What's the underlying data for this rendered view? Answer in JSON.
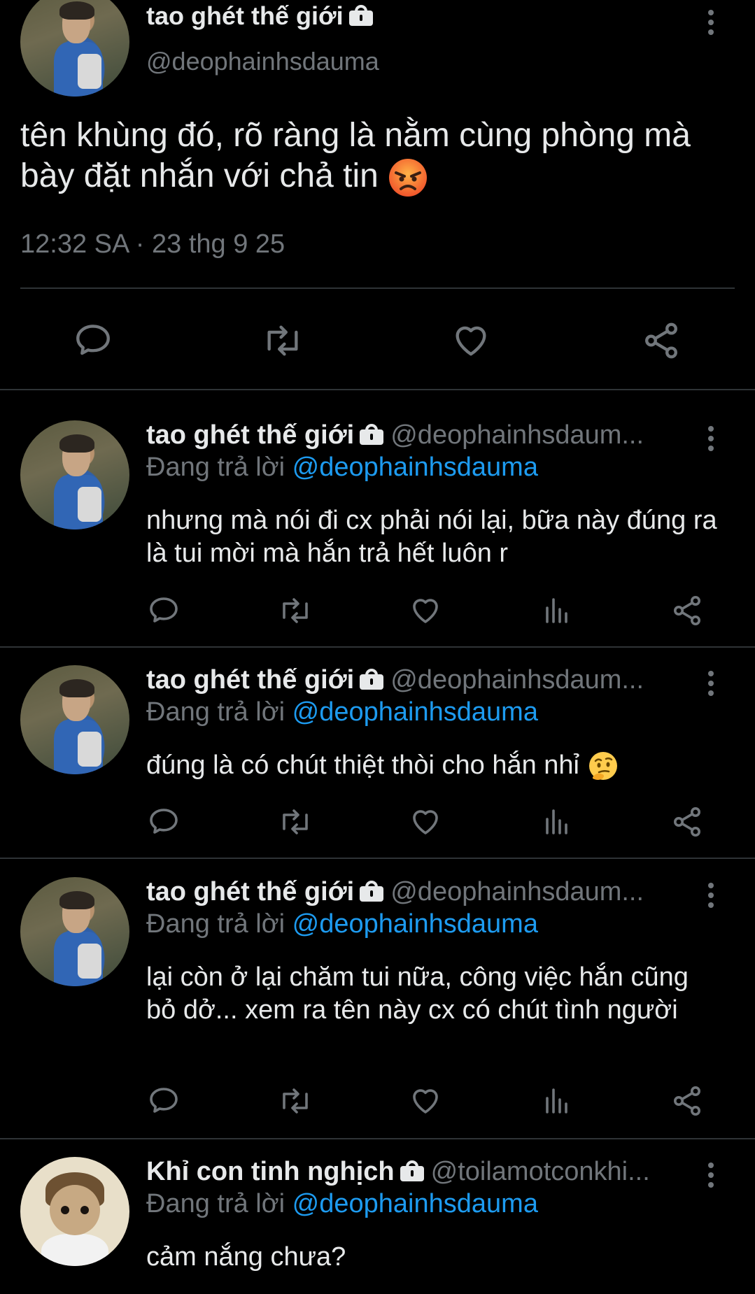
{
  "main_tweet": {
    "name": "tao ghét thế giới",
    "handle": "@deophainhsdauma",
    "text": "tên khùng đó, rõ ràng là nằm cùng phòng mà bày đặt nhắn với chả tin",
    "emoji": "angry-face",
    "timestamp": "12:32 SA · 23 thg 9 25",
    "actions": [
      "reply-icon",
      "retweet-icon",
      "like-icon",
      "share-icon"
    ]
  },
  "replies": [
    {
      "name": "tao ghét thế giới",
      "handle": "@deophainhsdaum...",
      "replying_prefix": "Đang trả lời",
      "replying_to": "@deophainhsdauma",
      "text": "nhưng mà nói đi cx phải nói lại, bữa này đúng ra là tui mời mà hắn trả hết luôn r"
    },
    {
      "name": "tao ghét thế giới",
      "handle": "@deophainhsdaum...",
      "replying_prefix": "Đang trả lời",
      "replying_to": "@deophainhsdauma",
      "text": "đúng là có chút thiệt thòi cho hắn nhỉ",
      "emoji": "thinking-face"
    },
    {
      "name": "tao ghét thế giới",
      "handle": "@deophainhsdaum...",
      "replying_prefix": "Đang trả lời",
      "replying_to": "@deophainhsdauma",
      "text": "lại còn ở lại chăm tui nữa, công việc hắn cũng bỏ dở... xem ra tên này cx có chút tình người"
    },
    {
      "name": "Khỉ con tinh nghịch",
      "handle": "@toilamotconkhi...",
      "replying_prefix": "Đang trả lời",
      "replying_to": "@deophainhsdauma",
      "text": "cảm nắng chưa?"
    }
  ],
  "colors": {
    "background": "#000000",
    "text": "#e7e9ea",
    "muted": "#71767b",
    "link": "#1d9bf0",
    "divider": "#2f3336"
  }
}
